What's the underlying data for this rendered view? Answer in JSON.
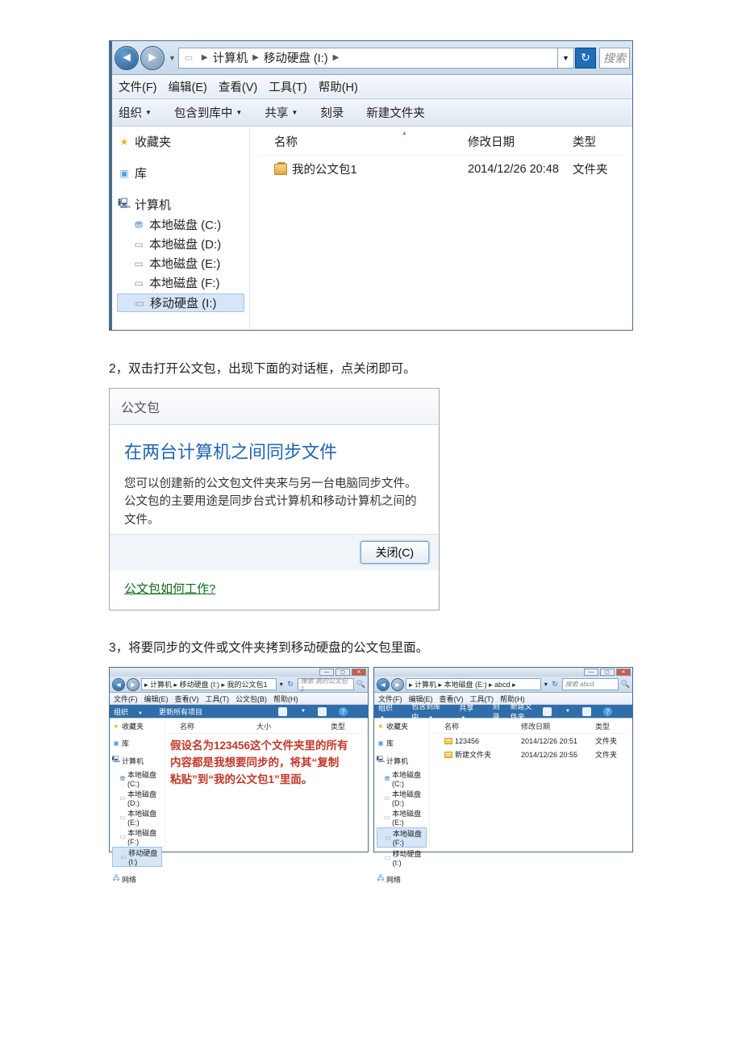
{
  "explorer1": {
    "crumb": {
      "computer": "计算机",
      "drive": "移动硬盘 (I:)"
    },
    "search_hint": "搜索",
    "menu": {
      "file": "文件(F)",
      "edit": "编辑(E)",
      "view": "查看(V)",
      "tools": "工具(T)",
      "help": "帮助(H)"
    },
    "cmd": {
      "organize": "组织",
      "include": "包含到库中",
      "share": "共享",
      "burn": "刻录",
      "newfolder": "新建文件夹"
    },
    "nav": {
      "favorites": "收藏夹",
      "library": "库",
      "computer": "计算机",
      "drive_c": "本地磁盘 (C:)",
      "drive_d": "本地磁盘 (D:)",
      "drive_e": "本地磁盘 (E:)",
      "drive_f": "本地磁盘 (F:)",
      "drive_i": "移动硬盘 (I:)"
    },
    "cols": {
      "name": "名称",
      "date": "修改日期",
      "type": "类型"
    },
    "row": {
      "name": "我的公文包1",
      "date": "2014/12/26 20:48",
      "type": "文件夹"
    }
  },
  "steps": {
    "s2": "2，双击打开公文包，出现下面的对话框，点关闭即可。",
    "s3": "3，将要同步的文件或文件夹拷到移动硬盘的公文包里面。"
  },
  "dialog": {
    "title": "公文包",
    "heading": "在两台计算机之间同步文件",
    "text": "您可以创建新的公文包文件夹来与另一台电脑同步文件。公文包的主要用途是同步台式计算机和移动计算机之间的文件。",
    "close": "关闭(C)",
    "link": "公文包如何工作?"
  },
  "small_left": {
    "crumb": "▸ 计算机 ▸ 移动硬盘 (I:) ▸ 我的公文包1",
    "search_hint": "搜索 我的公文包1",
    "menu": {
      "file": "文件(F)",
      "edit": "编辑(E)",
      "view": "查看(V)",
      "tools": "工具(T)",
      "briefcase": "公文包(B)",
      "help": "帮助(H)"
    },
    "cmd": {
      "organize": "组织",
      "update": "更新所有项目"
    },
    "cols": {
      "name": "名称",
      "size": "大小",
      "type": "类型"
    },
    "note_l1": "假设名为123456这个文件夹里的所有",
    "note_l2": "内容都是我想要同步的，将其“复制",
    "note_l3": "粘贴”到“我的公文包1”里面。",
    "network": "网络"
  },
  "small_right": {
    "crumb": "▸ 计算机 ▸ 本地磁盘 (E:) ▸ abcd ▸",
    "search_hint": "搜索 abcd",
    "menu": {
      "file": "文件(F)",
      "edit": "编辑(E)",
      "view": "查看(V)",
      "tools": "工具(T)",
      "help": "帮助(H)"
    },
    "cmd": {
      "organize": "组织",
      "include": "包含到库中",
      "share": "共享",
      "burn": "刻录",
      "newfolder": "新建文件夹"
    },
    "cols": {
      "name": "名称",
      "date": "修改日期",
      "type": "类型"
    },
    "rows": [
      {
        "name": "123456",
        "date": "2014/12/26 20:51",
        "type": "文件夹"
      },
      {
        "name": "新建文件夹",
        "date": "2014/12/26 20:55",
        "type": "文件夹"
      }
    ],
    "network": "网络"
  },
  "shared_nav": {
    "favorites": "收藏夹",
    "library": "库",
    "computer": "计算机",
    "drive_c": "本地磁盘 (C:)",
    "drive_d": "本地磁盘 (D:)",
    "drive_e": "本地磁盘 (E:)",
    "drive_f": "本地磁盘 (F:)",
    "drive_i": "移动硬盘 (I:)"
  }
}
